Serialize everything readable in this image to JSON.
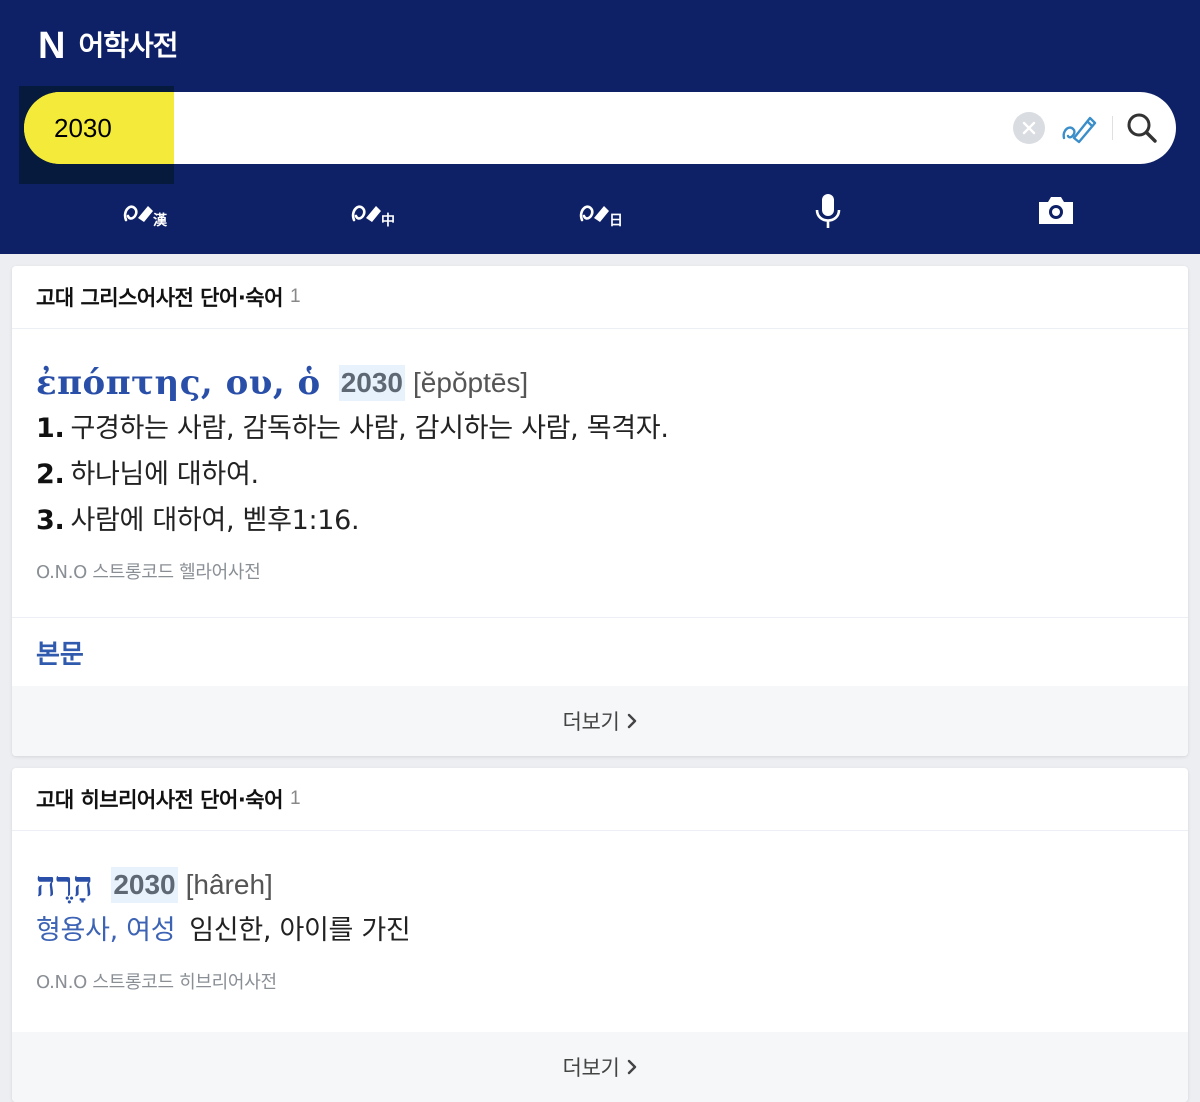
{
  "header": {
    "logo": "N",
    "title": "어학사전",
    "colors": {
      "background": "#0e2166",
      "query_highlight": "#f3ea3a"
    }
  },
  "search": {
    "query": "2030",
    "clear_icon": "close-circle-icon",
    "handwrite_icon": "handwriting-pen-icon",
    "search_icon": "magnifier-icon"
  },
  "tools": [
    {
      "name": "hanja-handwriting",
      "icon": "handwriting-icon",
      "badge": "漢"
    },
    {
      "name": "chinese-handwriting",
      "icon": "handwriting-icon",
      "badge": "中"
    },
    {
      "name": "japanese-handwriting",
      "icon": "handwriting-icon",
      "badge": "日"
    },
    {
      "name": "voice-search",
      "icon": "microphone-icon"
    },
    {
      "name": "image-search",
      "icon": "camera-icon"
    }
  ],
  "cards": [
    {
      "title": "고대 그리스어사전 단어·숙어",
      "count": "1",
      "entry": {
        "headword": "ἐπόπτης, ου, ὁ",
        "code": "2030",
        "pron": "[ĕpŏptēs]",
        "meanings": [
          {
            "num": "1.",
            "text": "구경하는 사람, 감독하는 사람, 감시하는 사람, 목격자."
          },
          {
            "num": "2.",
            "text": "하나님에 대하여."
          },
          {
            "num": "3.",
            "text": "사람에 대하여, 벧후1:16."
          }
        ],
        "source": "O.N.O 스트롱코드 헬라어사전"
      },
      "extra_link": "본문",
      "more": "더보기"
    },
    {
      "title": "고대 히브리어사전 단어·숙어",
      "count": "1",
      "entry": {
        "headword": "הָרֶה",
        "code": "2030",
        "pron": "[hâreh]",
        "pos": "형용사, 여성",
        "meaning": "임신한, 아이를 가진",
        "source": "O.N.O 스트롱코드 히브리어사전"
      },
      "more": "더보기"
    }
  ]
}
